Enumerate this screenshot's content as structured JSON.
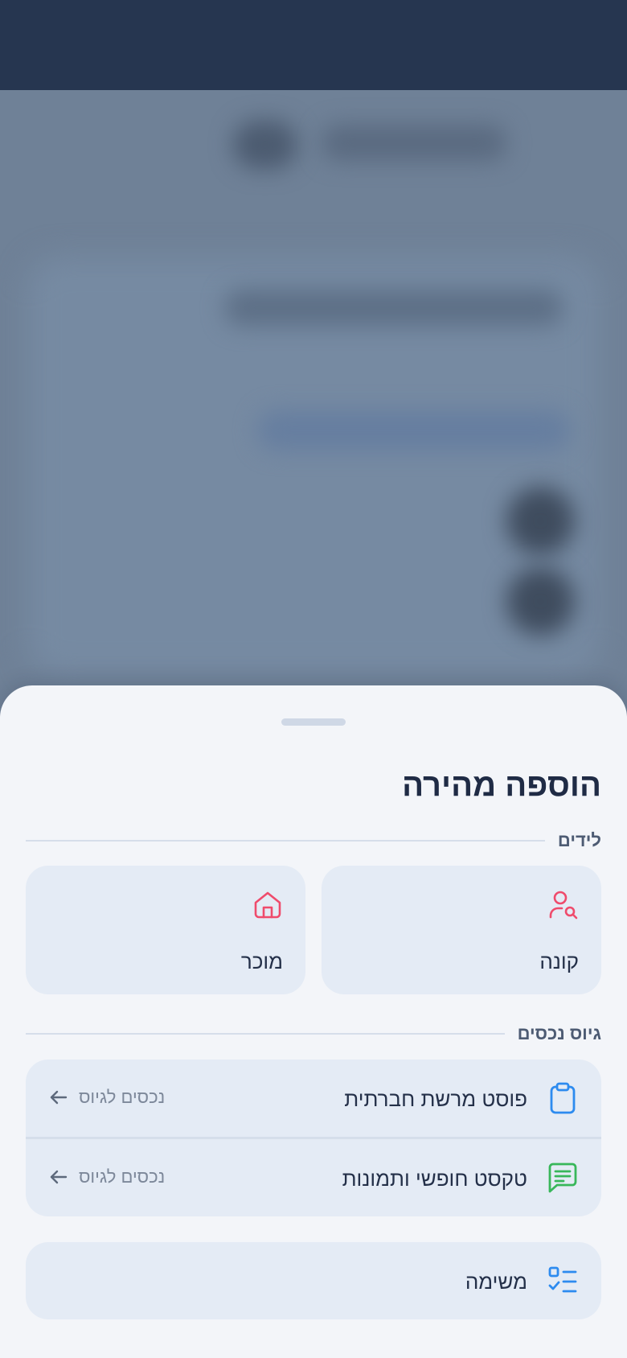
{
  "sheet": {
    "title": "הוספה מהירה",
    "sections": {
      "leads": {
        "label": "לידים",
        "items": [
          {
            "label": "קונה",
            "icon": "user-search-icon",
            "color": "#ef4b6c"
          },
          {
            "label": "מוכר",
            "icon": "home-icon",
            "color": "#ef4b6c"
          }
        ]
      },
      "properties": {
        "label": "גיוס נכסים",
        "items": [
          {
            "label": "פוסט מרשת חברתית",
            "icon": "clipboard-icon",
            "color": "#2d8bef",
            "action": "נכסים לגיוס"
          },
          {
            "label": "טקסט חופשי ותמונות",
            "icon": "message-text-icon",
            "color": "#38b75a",
            "action": "נכסים לגיוס"
          }
        ]
      },
      "task": {
        "label": "משימה",
        "icon": "task-list-icon",
        "color": "#2d8bef"
      }
    }
  }
}
